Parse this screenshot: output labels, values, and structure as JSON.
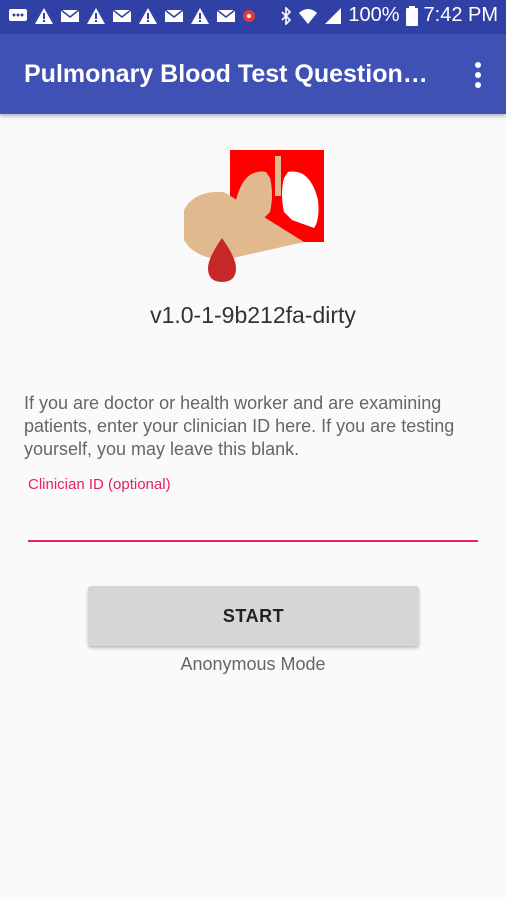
{
  "status_bar": {
    "battery": "100%",
    "time": "7:42 PM"
  },
  "app_bar": {
    "title": "Pulmonary Blood Test Question…"
  },
  "main": {
    "version": "v1.0-1-9b212fa-dirty",
    "info_text": "If you are doctor or health worker and are examining patients, enter your clinician ID here. If you are testing yourself, you may leave this blank.",
    "clinician_field": {
      "label": "Clinician ID (optional)",
      "value": ""
    },
    "start_label": "START",
    "mode_text": "Anonymous Mode"
  },
  "colors": {
    "status_bar": "#3140a4",
    "app_bar": "#3f51b5",
    "accent": "#e91e63",
    "button": "#d6d6d6"
  }
}
